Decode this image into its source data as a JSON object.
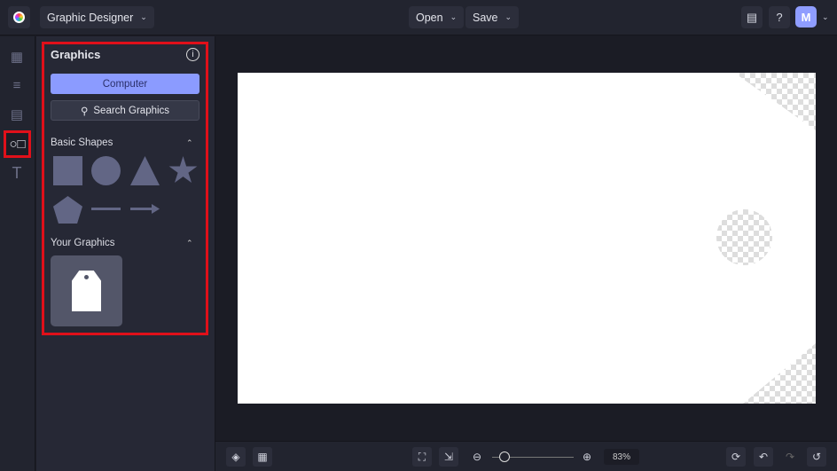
{
  "topbar": {
    "app_mode": "Graphic Designer",
    "open_label": "Open",
    "save_label": "Save",
    "avatar_initial": "M"
  },
  "panel": {
    "title": "Graphics",
    "computer_label": "Computer",
    "search_label": "Search Graphics",
    "basic_shapes_label": "Basic Shapes",
    "your_graphics_label": "Your Graphics"
  },
  "bottom": {
    "zoom_value": "83%"
  },
  "colors": {
    "accent": "#8b9bff",
    "highlight": "#e0101a"
  }
}
